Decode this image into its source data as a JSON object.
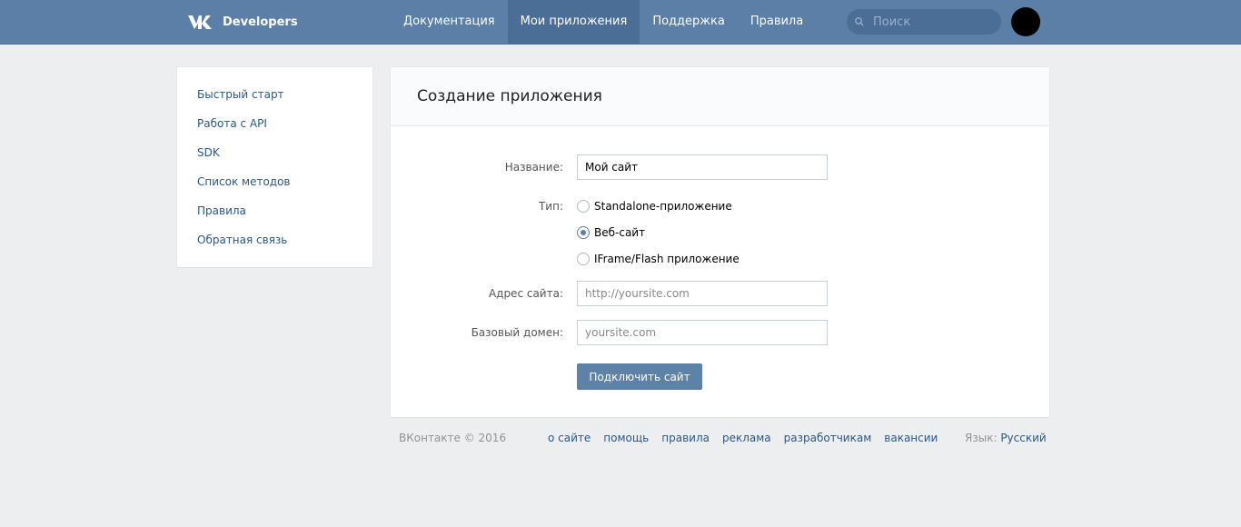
{
  "header": {
    "logo_text": "Developers",
    "nav": [
      {
        "label": "Документация"
      },
      {
        "label": "Мои приложения"
      },
      {
        "label": "Поддержка"
      },
      {
        "label": "Правила"
      }
    ],
    "search_placeholder": "Поиск"
  },
  "sidebar": {
    "items": [
      {
        "label": "Быстрый старт"
      },
      {
        "label": "Работа с API"
      },
      {
        "label": "SDK"
      },
      {
        "label": "Список методов"
      },
      {
        "label": "Правила"
      },
      {
        "label": "Обратная связь"
      }
    ]
  },
  "form": {
    "title": "Создание приложения",
    "name_label": "Название:",
    "name_value": "Мой сайт",
    "type_label": "Тип:",
    "type_options": [
      {
        "label": "Standalone-приложение",
        "checked": false
      },
      {
        "label": "Веб-сайт",
        "checked": true
      },
      {
        "label": "IFrame/Flash приложение",
        "checked": false
      }
    ],
    "site_label": "Адрес сайта:",
    "site_placeholder": "http://yoursite.com",
    "domain_label": "Базовый домен:",
    "domain_placeholder": "yoursite.com",
    "submit_label": "Подключить сайт"
  },
  "footer": {
    "copyright": "ВКонтакте © 2016",
    "links": [
      {
        "label": "о сайте"
      },
      {
        "label": "помощь"
      },
      {
        "label": "правила"
      },
      {
        "label": "реклама"
      },
      {
        "label": "разработчикам"
      },
      {
        "label": "вакансии"
      }
    ],
    "lang_label": "Язык:",
    "lang_value": "Русский"
  },
  "colors": {
    "header_bg": "#5b7fa6",
    "link": "#2a5885",
    "page_bg": "#edeef0"
  }
}
